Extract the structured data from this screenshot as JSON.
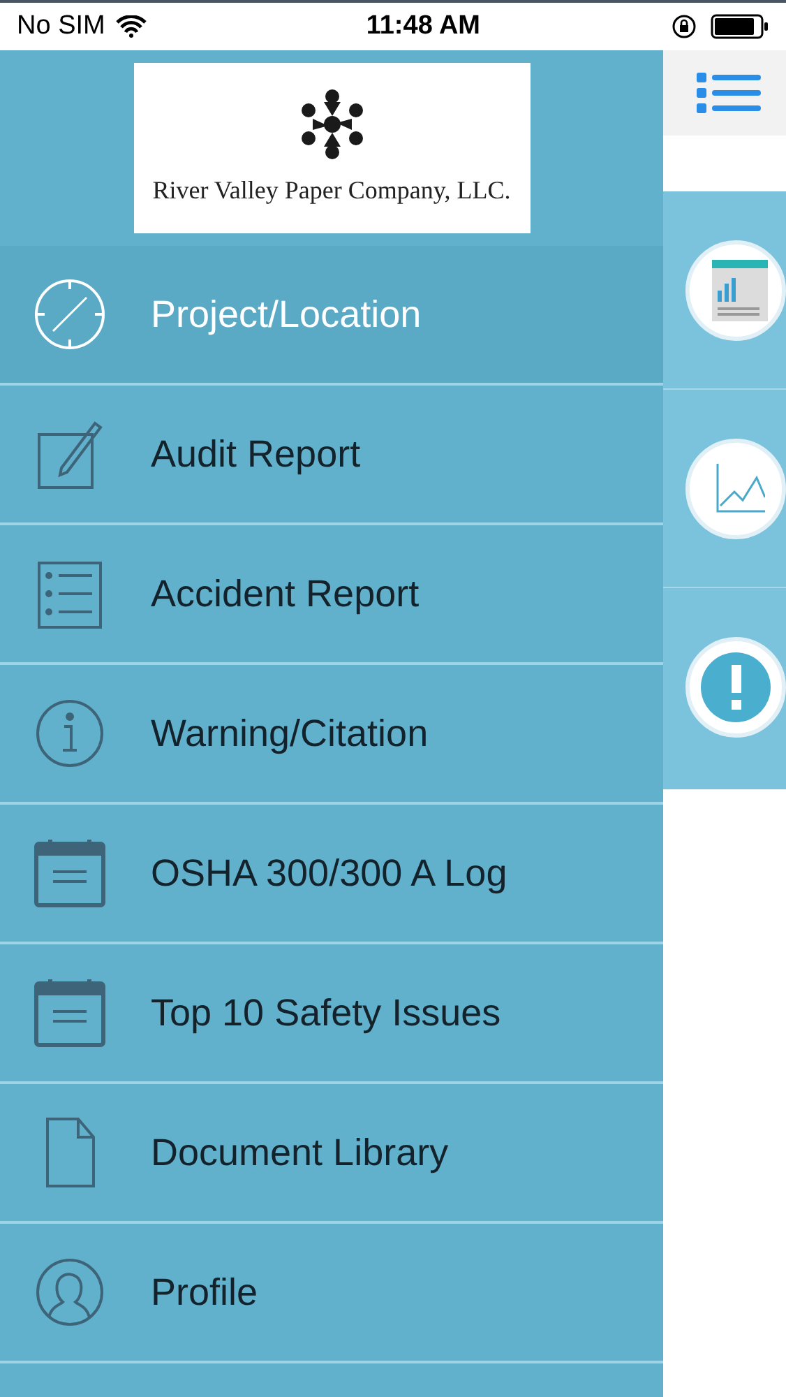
{
  "status_bar": {
    "carrier": "No SIM",
    "time": "11:48 AM"
  },
  "logo": {
    "caption": "River Valley Paper Company, LLC."
  },
  "menu": [
    {
      "label": "Project/Location",
      "selected": true
    },
    {
      "label": "Audit Report",
      "selected": false
    },
    {
      "label": "Accident Report",
      "selected": false
    },
    {
      "label": "Warning/Citation",
      "selected": false
    },
    {
      "label": "OSHA 300/300 A Log",
      "selected": false
    },
    {
      "label": "Top 10 Safety Issues",
      "selected": false
    },
    {
      "label": "Document Library",
      "selected": false
    },
    {
      "label": "Profile",
      "selected": false
    }
  ]
}
